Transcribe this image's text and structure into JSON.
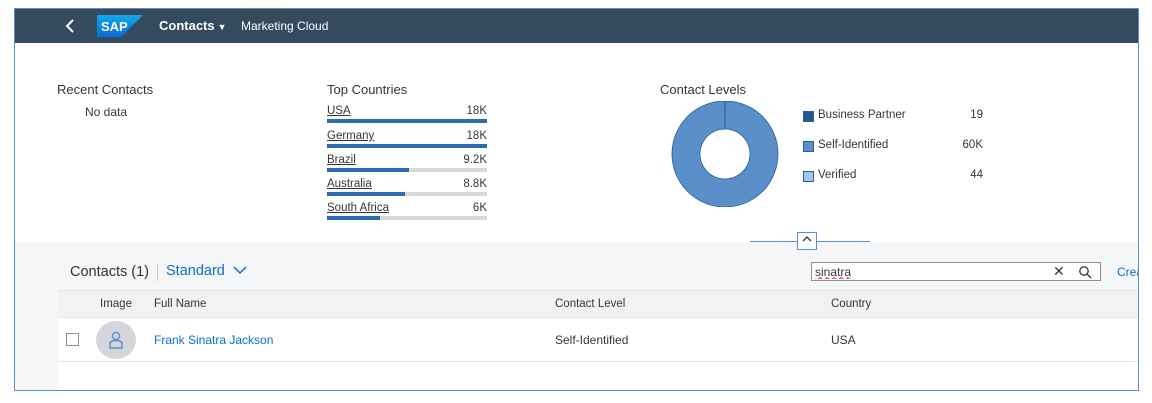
{
  "shell": {
    "logo_text": "SAP",
    "app_title": "Contacts",
    "subtitle": "Marketing Cloud"
  },
  "recent_contacts": {
    "title": "Recent Contacts",
    "empty_text": "No data"
  },
  "top_countries": {
    "title": "Top Countries",
    "items": [
      {
        "label": "USA",
        "value": "18K",
        "fraction": 1.0
      },
      {
        "label": "Germany",
        "value": "18K",
        "fraction": 1.0
      },
      {
        "label": "Brazil",
        "value": "9.2K",
        "fraction": 0.51
      },
      {
        "label": "Australia",
        "value": "8.8K",
        "fraction": 0.49
      },
      {
        "label": "South Africa",
        "value": "6K",
        "fraction": 0.33
      }
    ]
  },
  "contact_levels": {
    "title": "Contact Levels",
    "items": [
      {
        "label": "Business Partner",
        "value": "19",
        "color": "#1f5a96"
      },
      {
        "label": "Self-Identified",
        "value": "60K",
        "color": "#5b8fc9"
      },
      {
        "label": "Verified",
        "value": "44",
        "color": "#a9c4e6"
      }
    ]
  },
  "chart_data": {
    "type": "pie",
    "categories": [
      "Business Partner",
      "Self-Identified",
      "Verified"
    ],
    "values": [
      19,
      60000,
      44
    ],
    "title": "Contact Levels",
    "legend": "right"
  },
  "table": {
    "title": "Contacts (1)",
    "variant": "Standard",
    "search_value": "sinatra",
    "create_label": "Crea",
    "columns": [
      "Image",
      "Full Name",
      "Contact Level",
      "Country"
    ],
    "rows": [
      {
        "full_name": "Frank Sinatra Jackson",
        "contact_level": "Self-Identified",
        "country": "USA"
      }
    ]
  },
  "colors": {
    "shell_bg": "#354a5f",
    "link": "#0a6ed1",
    "bar": "#2b6cb0"
  },
  "icons": {
    "back": "chevron-left-icon",
    "search": "search-icon",
    "clear": "clear-icon",
    "collapse": "chevron-up-icon",
    "avatar": "person-icon"
  }
}
